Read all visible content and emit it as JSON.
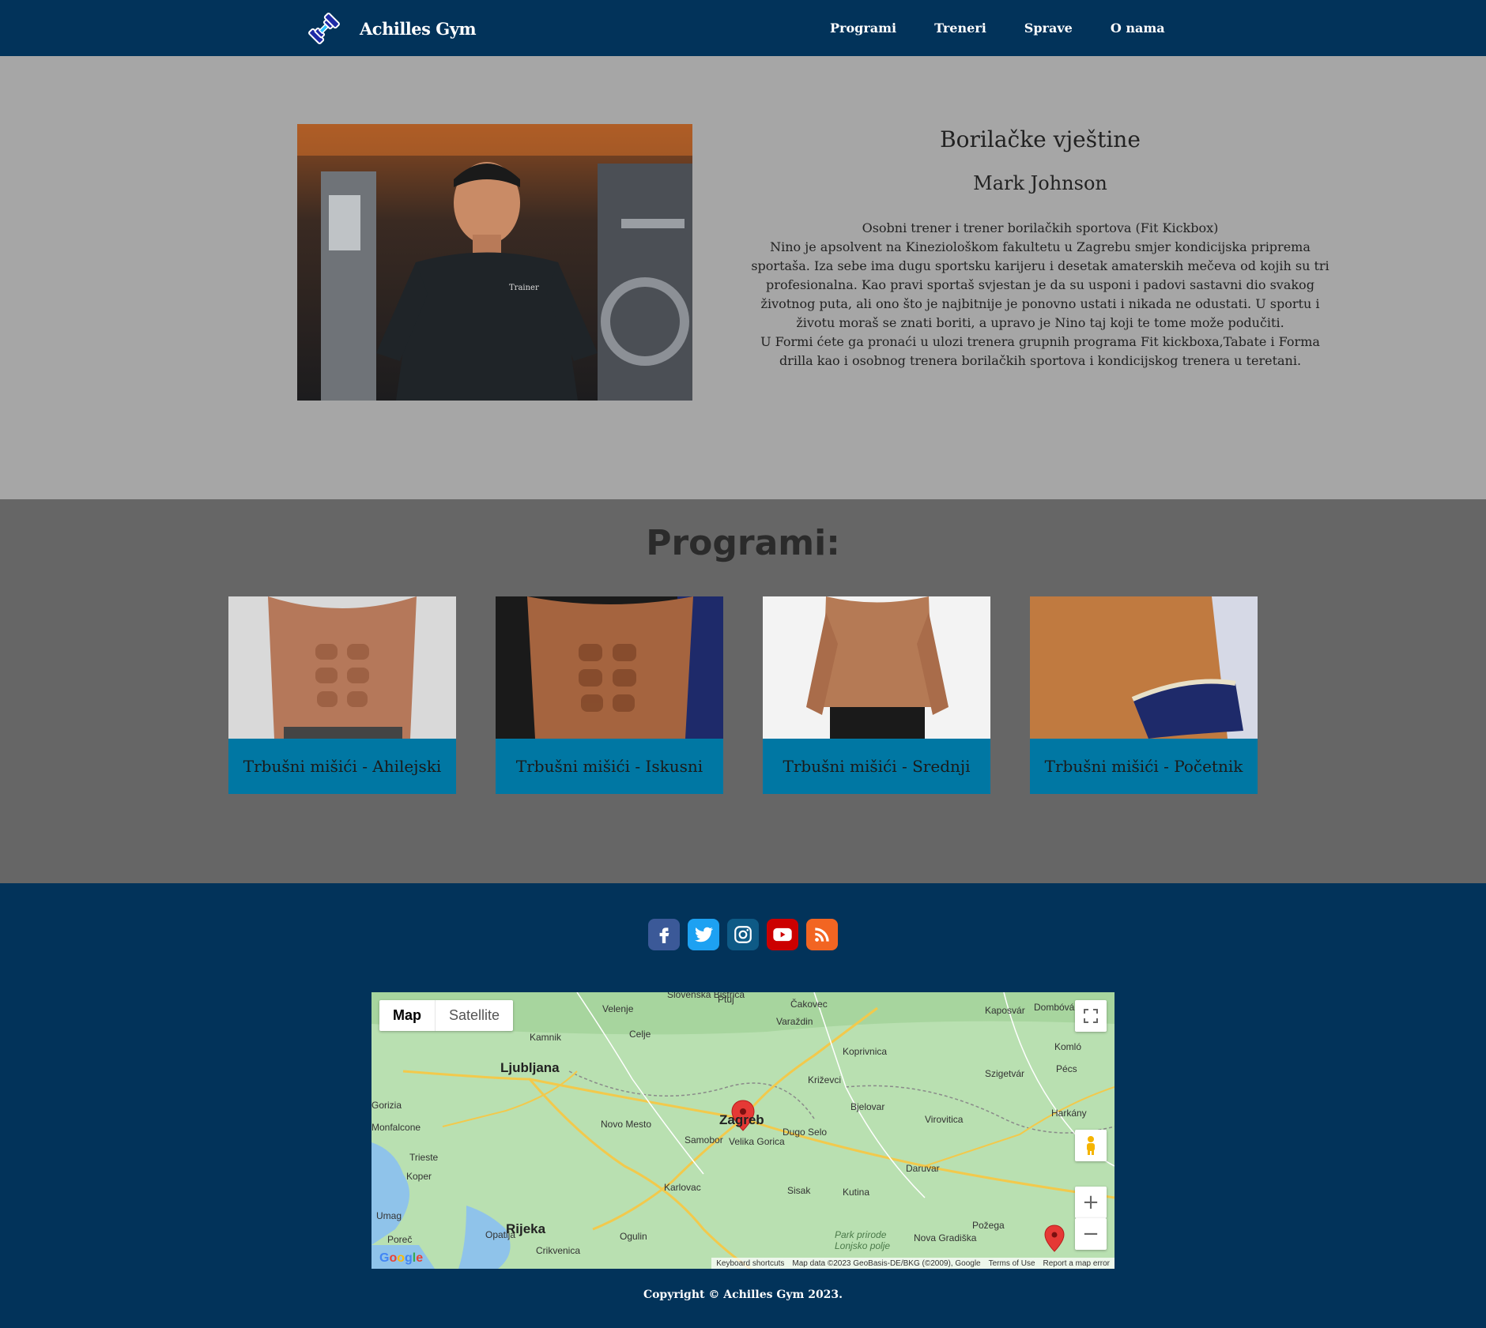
{
  "nav": {
    "brand": "Achilles Gym",
    "links": [
      "Programi",
      "Treneri",
      "Sprave",
      "O nama"
    ]
  },
  "hero": {
    "title": "Borilačke vještine",
    "name": "Mark Johnson",
    "description": [
      "Osobni trener i trener borilačkih sportova (Fit Kickbox)",
      "Nino je apsolvent na Kineziološkom fakultetu u Zagrebu smjer kondicijska priprema sportaša. Iza sebe ima dugu sportsku karijeru i desetak amaterskih mečeva od kojih su tri profesionalna. Kao pravi sportaš svjestan je da su usponi i padovi sastavni dio svakog životnog puta, ali ono što je najbitnije je ponovno ustati i nikada ne odustati. U sportu i životu moraš se znati boriti, a upravo je Nino taj koji te tome može podučiti.",
      "U Formi ćete ga pronaći u ulozi trenera grupnih programa Fit kickboxa,Tabate i Forma drilla kao i osobnog trenera borilačkih sportova i kondicijskog trenera u teretani."
    ],
    "photo_text": "Trainer"
  },
  "programs": {
    "title": "Programi:",
    "cards": [
      {
        "label": "Trbušni mišići - Ahilejski"
      },
      {
        "label": "Trbušni mišići - Iskusni"
      },
      {
        "label": "Trbušni mišići - Srednji"
      },
      {
        "label": "Trbušni mišići - Početnik"
      }
    ]
  },
  "footer": {
    "socials": [
      {
        "icon": "facebook-icon",
        "color": "#3b5998"
      },
      {
        "icon": "twitter-icon",
        "color": "#1da1f2"
      },
      {
        "icon": "instagram-icon",
        "color": "#0e5a86"
      },
      {
        "icon": "youtube-icon",
        "color": "#cc0000"
      },
      {
        "icon": "rss-icon",
        "color": "#f26522"
      }
    ],
    "copyright": "Copyright © Achilles Gym 2023."
  },
  "map": {
    "btn_map": "Map",
    "btn_satellite": "Satellite",
    "footer_items": [
      "Keyboard shortcuts",
      "Map data ©2023 GeoBasis-DE/BKG (©2009), Google",
      "Terms of Use",
      "Report a map error"
    ],
    "google_label": "Google",
    "cities": [
      {
        "name": "Ljubljana",
        "big": true
      },
      {
        "name": "Zagreb",
        "big": true
      },
      {
        "name": "Rijeka",
        "big": true
      },
      {
        "name": "Celje"
      },
      {
        "name": "Velenje"
      },
      {
        "name": "Kamnik"
      },
      {
        "name": "Novo Mesto"
      },
      {
        "name": "Samobor"
      },
      {
        "name": "Velika Gorica"
      },
      {
        "name": "Dugo Selo"
      },
      {
        "name": "Karlovac"
      },
      {
        "name": "Sisak"
      },
      {
        "name": "Kutina"
      },
      {
        "name": "Daruvar"
      },
      {
        "name": "Bjelovar"
      },
      {
        "name": "Križevci"
      },
      {
        "name": "Koprivnica"
      },
      {
        "name": "Varaždin"
      },
      {
        "name": "Čakovec"
      },
      {
        "name": "Ptuj"
      },
      {
        "name": "Kaposvár"
      },
      {
        "name": "Dombóvár"
      },
      {
        "name": "Komló"
      },
      {
        "name": "Pécs"
      },
      {
        "name": "Szigetvár"
      },
      {
        "name": "Harkány"
      },
      {
        "name": "Virovitica"
      },
      {
        "name": "Požega"
      },
      {
        "name": "Nova Gradiška"
      },
      {
        "name": "Ogulin"
      },
      {
        "name": "Opatija"
      },
      {
        "name": "Crikvenica"
      },
      {
        "name": "Trieste"
      },
      {
        "name": "Koper"
      },
      {
        "name": "Umag"
      },
      {
        "name": "Poreč"
      },
      {
        "name": "Gorizia"
      },
      {
        "name": "Monfalcone"
      },
      {
        "name": "Slovenska Bistrica"
      },
      {
        "name": "Park prirode Lonjsko polje"
      }
    ]
  }
}
